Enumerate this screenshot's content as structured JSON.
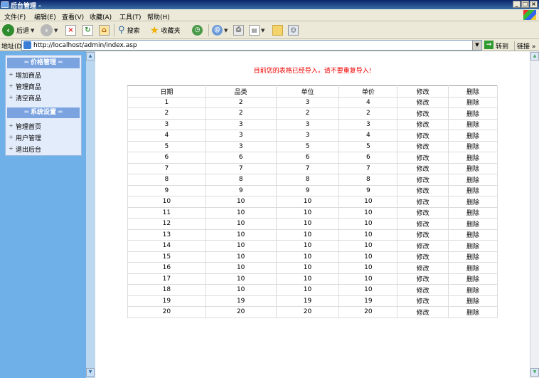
{
  "window": {
    "title": "后台管理 -",
    "buttons": [
      "_",
      "□",
      "×"
    ]
  },
  "menubar": {
    "items": [
      "文件(F)",
      "编辑(E)",
      "查看(V)",
      "收藏(A)",
      "工具(T)",
      "帮助(H)"
    ]
  },
  "toolbar": {
    "back_label": "后退",
    "search_label": "搜索",
    "favorites_label": "收藏夹"
  },
  "address": {
    "label": "地址(D)",
    "url": "http://localhost/admin/index.asp",
    "go_label": "转到",
    "links_label": "链接 »"
  },
  "sidebar": {
    "section1_title": "═ 价格管理 ═",
    "section1_items": [
      "增加商品",
      "管理商品",
      "清空商品"
    ],
    "section2_title": "═ 系统设置 ═",
    "section2_items": [
      "管理首页",
      "用户管理",
      "退出后台"
    ],
    "bullet": "+"
  },
  "main": {
    "notice": "目前您的表格已经导入，请不要重复导入!",
    "table": {
      "headers": [
        "日期",
        "品类",
        "单位",
        "单价",
        "修改",
        "删除"
      ],
      "rows": [
        [
          "1",
          "2",
          "3",
          "4",
          "修改",
          "删除"
        ],
        [
          "2",
          "2",
          "2",
          "2",
          "修改",
          "删除"
        ],
        [
          "3",
          "3",
          "3",
          "3",
          "修改",
          "删除"
        ],
        [
          "4",
          "3",
          "3",
          "4",
          "修改",
          "删除"
        ],
        [
          "5",
          "3",
          "5",
          "5",
          "修改",
          "删除"
        ],
        [
          "6",
          "6",
          "6",
          "6",
          "修改",
          "删除"
        ],
        [
          "7",
          "7",
          "7",
          "7",
          "修改",
          "删除"
        ],
        [
          "8",
          "8",
          "8",
          "8",
          "修改",
          "删除"
        ],
        [
          "9",
          "9",
          "9",
          "9",
          "修改",
          "删除"
        ],
        [
          "10",
          "10",
          "10",
          "10",
          "修改",
          "删除"
        ],
        [
          "11",
          "10",
          "10",
          "10",
          "修改",
          "删除"
        ],
        [
          "12",
          "10",
          "10",
          "10",
          "修改",
          "删除"
        ],
        [
          "13",
          "10",
          "10",
          "10",
          "修改",
          "删除"
        ],
        [
          "14",
          "10",
          "10",
          "10",
          "修改",
          "删除"
        ],
        [
          "15",
          "10",
          "10",
          "10",
          "修改",
          "删除"
        ],
        [
          "16",
          "10",
          "10",
          "10",
          "修改",
          "删除"
        ],
        [
          "17",
          "10",
          "10",
          "10",
          "修改",
          "删除"
        ],
        [
          "18",
          "10",
          "10",
          "10",
          "修改",
          "删除"
        ],
        [
          "19",
          "19",
          "19",
          "19",
          "修改",
          "删除"
        ],
        [
          "20",
          "20",
          "20",
          "20",
          "修改",
          "删除"
        ]
      ]
    }
  },
  "icons": {
    "forward": "forward-arrow-icon",
    "stop": "stop-icon",
    "refresh": "refresh-icon",
    "home": "home-icon",
    "history": "history-icon",
    "mail": "mail-icon",
    "print": "print-icon",
    "edit": "edit-icon",
    "folder": "folder-icon",
    "messenger": "messenger-icon"
  },
  "colors": {
    "left_frame": "#6fb0e8",
    "menu_header": "#7aa3e0",
    "notice": "#e00000"
  }
}
